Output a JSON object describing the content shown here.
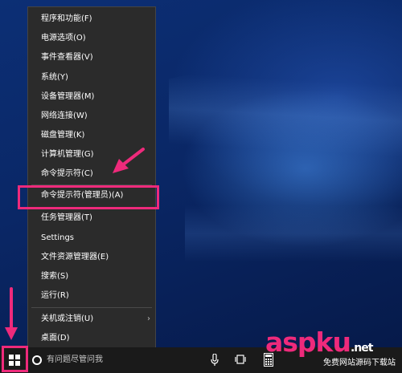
{
  "context_menu": {
    "items": [
      {
        "label": "程序和功能(F)"
      },
      {
        "label": "电源选项(O)"
      },
      {
        "label": "事件查看器(V)"
      },
      {
        "label": "系统(Y)"
      },
      {
        "label": "设备管理器(M)"
      },
      {
        "label": "网络连接(W)"
      },
      {
        "label": "磁盘管理(K)"
      },
      {
        "label": "计算机管理(G)"
      },
      {
        "label": "命令提示符(C)"
      },
      {
        "label": "命令提示符(管理员)(A)",
        "highlighted": true
      },
      {
        "label": "任务管理器(T)"
      },
      {
        "label": "Settings"
      },
      {
        "label": "文件资源管理器(E)"
      },
      {
        "label": "搜索(S)"
      },
      {
        "label": "运行(R)"
      },
      {
        "label": "关机或注销(U)",
        "has_submenu": true
      },
      {
        "label": "桌面(D)"
      }
    ]
  },
  "taskbar": {
    "search_placeholder": "有问题尽管问我",
    "icons": [
      "windows-start-icon",
      "cortana-circle-icon",
      "microphone-icon",
      "task-view-icon",
      "calculator-icon"
    ]
  },
  "watermark": {
    "brand": "aspku",
    "tld": ".net",
    "subtitle": "免费网站源码下载站"
  },
  "colors": {
    "highlight": "#ee2a7b",
    "menu_bg": "#2b2b2b",
    "taskbar_bg": "#1a1a1a"
  }
}
